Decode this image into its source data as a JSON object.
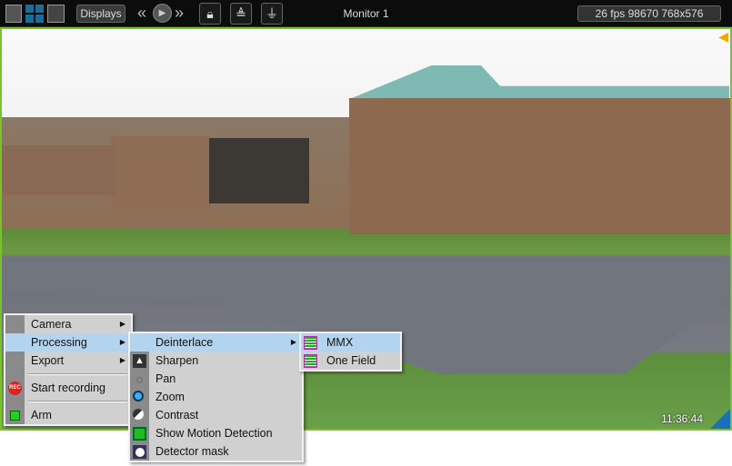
{
  "toolbar": {
    "displays_label": "Displays",
    "title": "Monitor 1",
    "status": "26 fps  98670 768x576",
    "icons": [
      "single-layout-icon",
      "quad-layout-icon",
      "multi-layout-icon",
      "rewind-icon",
      "play-icon",
      "fast-forward-icon",
      "lock-icon",
      "lock-all-icon",
      "record-download-icon"
    ]
  },
  "video": {
    "timestamp": "11:36:44"
  },
  "context_menu": {
    "items": [
      {
        "label": "Camera",
        "submenu": true
      },
      {
        "label": "Processing",
        "submenu": true,
        "highlighted": true
      },
      {
        "label": "Export",
        "submenu": true
      },
      {
        "label": "Start recording",
        "icon": "rec-icon"
      },
      {
        "label": "Arm",
        "icon": "arm-icon"
      }
    ]
  },
  "processing_menu": {
    "items": [
      {
        "label": "Deinterlace",
        "submenu": true,
        "highlighted": true
      },
      {
        "label": "Sharpen",
        "icon": "sharpen-icon"
      },
      {
        "label": "Pan",
        "icon": "pan-icon"
      },
      {
        "label": "Zoom",
        "icon": "zoom-icon"
      },
      {
        "label": "Contrast",
        "icon": "contrast-icon"
      },
      {
        "label": "Show Motion Detection",
        "icon": "motion-detection-icon"
      },
      {
        "label": "Detector mask",
        "icon": "detector-mask-icon"
      }
    ]
  },
  "deinterlace_menu": {
    "items": [
      {
        "label": "MMX",
        "icon": "deinterlace-icon",
        "highlighted": true
      },
      {
        "label": "One Field",
        "icon": "deinterlace-icon"
      }
    ]
  },
  "colors": {
    "frame_border": "#7ac22a",
    "highlight": "#b2d4ef",
    "menu_bg": "#d0d0d0"
  }
}
